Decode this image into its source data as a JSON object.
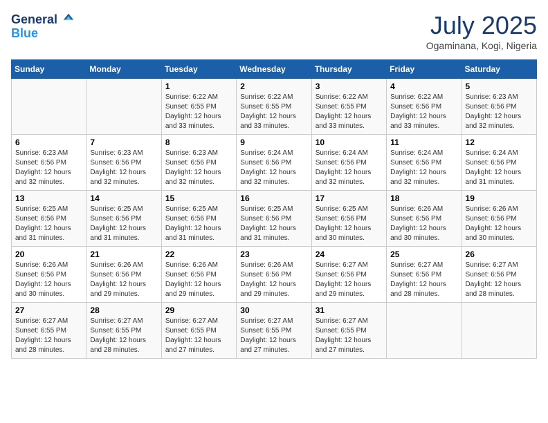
{
  "header": {
    "logo_line1": "General",
    "logo_line2": "Blue",
    "month_title": "July 2025",
    "subtitle": "Ogaminana, Kogi, Nigeria"
  },
  "days_of_week": [
    "Sunday",
    "Monday",
    "Tuesday",
    "Wednesday",
    "Thursday",
    "Friday",
    "Saturday"
  ],
  "weeks": [
    [
      {
        "day": "",
        "detail": ""
      },
      {
        "day": "",
        "detail": ""
      },
      {
        "day": "1",
        "detail": "Sunrise: 6:22 AM\nSunset: 6:55 PM\nDaylight: 12 hours\nand 33 minutes."
      },
      {
        "day": "2",
        "detail": "Sunrise: 6:22 AM\nSunset: 6:55 PM\nDaylight: 12 hours\nand 33 minutes."
      },
      {
        "day": "3",
        "detail": "Sunrise: 6:22 AM\nSunset: 6:55 PM\nDaylight: 12 hours\nand 33 minutes."
      },
      {
        "day": "4",
        "detail": "Sunrise: 6:22 AM\nSunset: 6:56 PM\nDaylight: 12 hours\nand 33 minutes."
      },
      {
        "day": "5",
        "detail": "Sunrise: 6:23 AM\nSunset: 6:56 PM\nDaylight: 12 hours\nand 32 minutes."
      }
    ],
    [
      {
        "day": "6",
        "detail": "Sunrise: 6:23 AM\nSunset: 6:56 PM\nDaylight: 12 hours\nand 32 minutes."
      },
      {
        "day": "7",
        "detail": "Sunrise: 6:23 AM\nSunset: 6:56 PM\nDaylight: 12 hours\nand 32 minutes."
      },
      {
        "day": "8",
        "detail": "Sunrise: 6:23 AM\nSunset: 6:56 PM\nDaylight: 12 hours\nand 32 minutes."
      },
      {
        "day": "9",
        "detail": "Sunrise: 6:24 AM\nSunset: 6:56 PM\nDaylight: 12 hours\nand 32 minutes."
      },
      {
        "day": "10",
        "detail": "Sunrise: 6:24 AM\nSunset: 6:56 PM\nDaylight: 12 hours\nand 32 minutes."
      },
      {
        "day": "11",
        "detail": "Sunrise: 6:24 AM\nSunset: 6:56 PM\nDaylight: 12 hours\nand 32 minutes."
      },
      {
        "day": "12",
        "detail": "Sunrise: 6:24 AM\nSunset: 6:56 PM\nDaylight: 12 hours\nand 31 minutes."
      }
    ],
    [
      {
        "day": "13",
        "detail": "Sunrise: 6:25 AM\nSunset: 6:56 PM\nDaylight: 12 hours\nand 31 minutes."
      },
      {
        "day": "14",
        "detail": "Sunrise: 6:25 AM\nSunset: 6:56 PM\nDaylight: 12 hours\nand 31 minutes."
      },
      {
        "day": "15",
        "detail": "Sunrise: 6:25 AM\nSunset: 6:56 PM\nDaylight: 12 hours\nand 31 minutes."
      },
      {
        "day": "16",
        "detail": "Sunrise: 6:25 AM\nSunset: 6:56 PM\nDaylight: 12 hours\nand 31 minutes."
      },
      {
        "day": "17",
        "detail": "Sunrise: 6:25 AM\nSunset: 6:56 PM\nDaylight: 12 hours\nand 30 minutes."
      },
      {
        "day": "18",
        "detail": "Sunrise: 6:26 AM\nSunset: 6:56 PM\nDaylight: 12 hours\nand 30 minutes."
      },
      {
        "day": "19",
        "detail": "Sunrise: 6:26 AM\nSunset: 6:56 PM\nDaylight: 12 hours\nand 30 minutes."
      }
    ],
    [
      {
        "day": "20",
        "detail": "Sunrise: 6:26 AM\nSunset: 6:56 PM\nDaylight: 12 hours\nand 30 minutes."
      },
      {
        "day": "21",
        "detail": "Sunrise: 6:26 AM\nSunset: 6:56 PM\nDaylight: 12 hours\nand 29 minutes."
      },
      {
        "day": "22",
        "detail": "Sunrise: 6:26 AM\nSunset: 6:56 PM\nDaylight: 12 hours\nand 29 minutes."
      },
      {
        "day": "23",
        "detail": "Sunrise: 6:26 AM\nSunset: 6:56 PM\nDaylight: 12 hours\nand 29 minutes."
      },
      {
        "day": "24",
        "detail": "Sunrise: 6:27 AM\nSunset: 6:56 PM\nDaylight: 12 hours\nand 29 minutes."
      },
      {
        "day": "25",
        "detail": "Sunrise: 6:27 AM\nSunset: 6:56 PM\nDaylight: 12 hours\nand 28 minutes."
      },
      {
        "day": "26",
        "detail": "Sunrise: 6:27 AM\nSunset: 6:56 PM\nDaylight: 12 hours\nand 28 minutes."
      }
    ],
    [
      {
        "day": "27",
        "detail": "Sunrise: 6:27 AM\nSunset: 6:55 PM\nDaylight: 12 hours\nand 28 minutes."
      },
      {
        "day": "28",
        "detail": "Sunrise: 6:27 AM\nSunset: 6:55 PM\nDaylight: 12 hours\nand 28 minutes."
      },
      {
        "day": "29",
        "detail": "Sunrise: 6:27 AM\nSunset: 6:55 PM\nDaylight: 12 hours\nand 27 minutes."
      },
      {
        "day": "30",
        "detail": "Sunrise: 6:27 AM\nSunset: 6:55 PM\nDaylight: 12 hours\nand 27 minutes."
      },
      {
        "day": "31",
        "detail": "Sunrise: 6:27 AM\nSunset: 6:55 PM\nDaylight: 12 hours\nand 27 minutes."
      },
      {
        "day": "",
        "detail": ""
      },
      {
        "day": "",
        "detail": ""
      }
    ]
  ]
}
